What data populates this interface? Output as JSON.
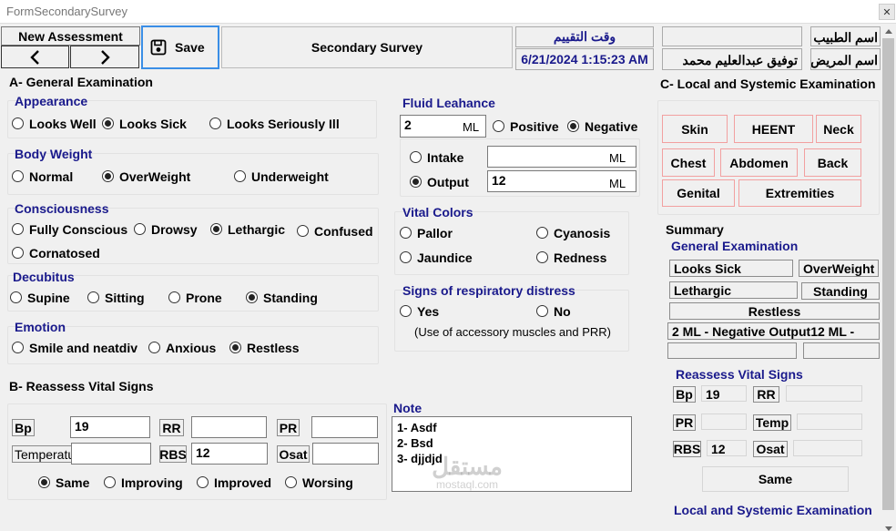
{
  "window": {
    "title": "FormSecondarySurvey",
    "close_glyph": "✕"
  },
  "header": {
    "new_assessment": "New Assessment",
    "prev": "<",
    "next": ">",
    "save": "Save",
    "title": "Secondary Survey",
    "eval_time_label": "وقت التقييم",
    "eval_time_value": "6/21/2024 1:15:23 AM",
    "doctor_label": "اسم الطبيب :",
    "doctor_value": "",
    "patient_label": "اسم المريض :",
    "patient_value": "توفيق عبدالعليم محمد"
  },
  "general": {
    "title": "A- General Examination",
    "appearance": {
      "label": "Appearance",
      "options": [
        "Looks Well",
        "Looks Sick",
        "Looks Seriously Ill"
      ],
      "selected": "Looks Sick"
    },
    "body_weight": {
      "label": "Body Weight",
      "options": [
        "Normal",
        "OverWeight",
        "Underweight"
      ],
      "selected": "OverWeight"
    },
    "consciousness": {
      "label": "Consciousness",
      "options": [
        "Fully Conscious",
        "Drowsy",
        "Lethargic",
        "Confused",
        "Cornatosed"
      ],
      "selected": "Lethargic"
    },
    "decubitus": {
      "label": "Decubitus",
      "options": [
        "Supine",
        "Sitting",
        "Prone",
        "Standing"
      ],
      "selected": "Standing"
    },
    "emotion": {
      "label": "Emotion",
      "options": [
        "Smile and neatdiv",
        "Anxious",
        "Restless"
      ],
      "selected": "Restless"
    }
  },
  "fluid": {
    "label": "Fluid Leahance",
    "amount": "2",
    "unit": "ML",
    "options": [
      "Positive",
      "Negative"
    ],
    "selected": "Negative",
    "intake_label": "Intake",
    "intake_value": "",
    "output_label": "Output",
    "output_value": "12",
    "io_selected": "Output"
  },
  "vital_colors": {
    "label": "Vital Colors",
    "options": [
      "Pallor",
      "Cyanosis",
      "Jaundice",
      "Redness"
    ],
    "selected": ""
  },
  "resp": {
    "label": "Signs of respiratory distress",
    "options": [
      "Yes",
      "No"
    ],
    "note": "(Use of accessory muscles and PRR)"
  },
  "local": {
    "title": "C-  Local and Systemic Examination",
    "buttons": [
      "Skin",
      "HEENT",
      "Neck",
      "Chest",
      "Abdomen",
      "Back",
      "Genital",
      "Extremities"
    ]
  },
  "vitals": {
    "title": "B- Reassess Vital Signs",
    "bp_label": "Bp",
    "bp_value": "19",
    "rr_label": "RR",
    "rr_value": "",
    "pr_label": "PR",
    "pr_value": "",
    "temp_label": "Temperatu",
    "temp_value": "",
    "rbs_label": "RBS",
    "rbs_value": "12",
    "osat_label": "Osat",
    "osat_value": "",
    "trend_options": [
      "Same",
      "Improving",
      "Improved",
      "Worsing"
    ],
    "trend_selected": "Same"
  },
  "note": {
    "label": "Note",
    "lines": [
      "1- Asdf",
      "2- Bsd",
      "3- djjdjd"
    ]
  },
  "summary": {
    "title": "Summary",
    "general_title": "General Examination",
    "appearance": "Looks Sick",
    "weight": "OverWeight",
    "consciousness": "Lethargic",
    "decubitus": "Standing",
    "emotion": "Restless",
    "fluid": "2 ML - Negative Output12 ML -",
    "vitals_title": "Reassess Vital Signs",
    "bp_label": "Bp",
    "bp_value": "19",
    "rr_label": "RR",
    "rr_value": "",
    "pr_label": "PR",
    "pr_value": "",
    "temp_label": "Temp",
    "temp_value": "",
    "rbs_label": "RBS",
    "rbs_value": "12",
    "osat_label": "Osat",
    "osat_value": "",
    "trend": "Same",
    "local_title": "Local and Systemic Examination"
  },
  "watermark": {
    "text": "مستقل",
    "sub": "mostaql.com"
  }
}
